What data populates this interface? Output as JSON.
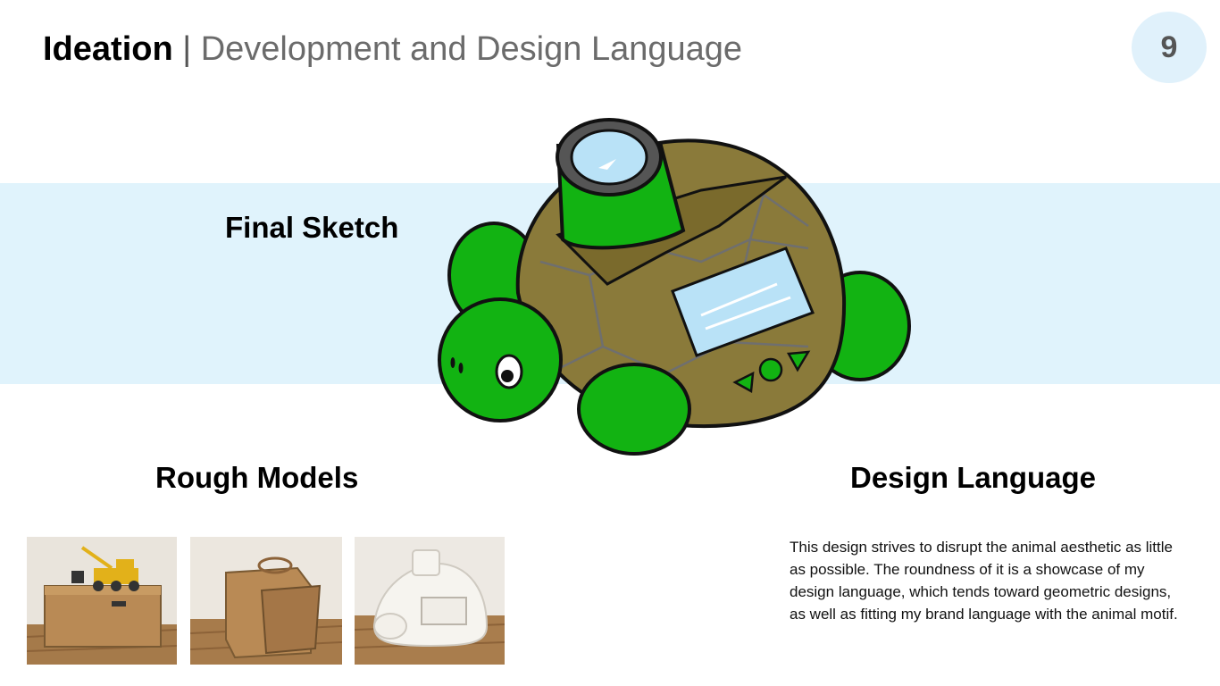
{
  "header": {
    "title_bold": "Ideation",
    "separator": "|",
    "title_rest": "Development and Design Language",
    "page_number": "9"
  },
  "sections": {
    "final_sketch": "Final Sketch",
    "rough_models": "Rough Models",
    "design_language": "Design Language"
  },
  "description": "This design strives to disrupt the animal aesthetic as little as possible. The roundness of it is a showcase of my design language, which tends toward geometric designs, as well as fitting my brand language with the animal motif.",
  "colors": {
    "band": "#e0f3fc",
    "page_circle": "#e0f1fb",
    "turtle_green": "#12b312",
    "shell_brown": "#8a7a3a",
    "screen_blue": "#b9e2f7"
  }
}
